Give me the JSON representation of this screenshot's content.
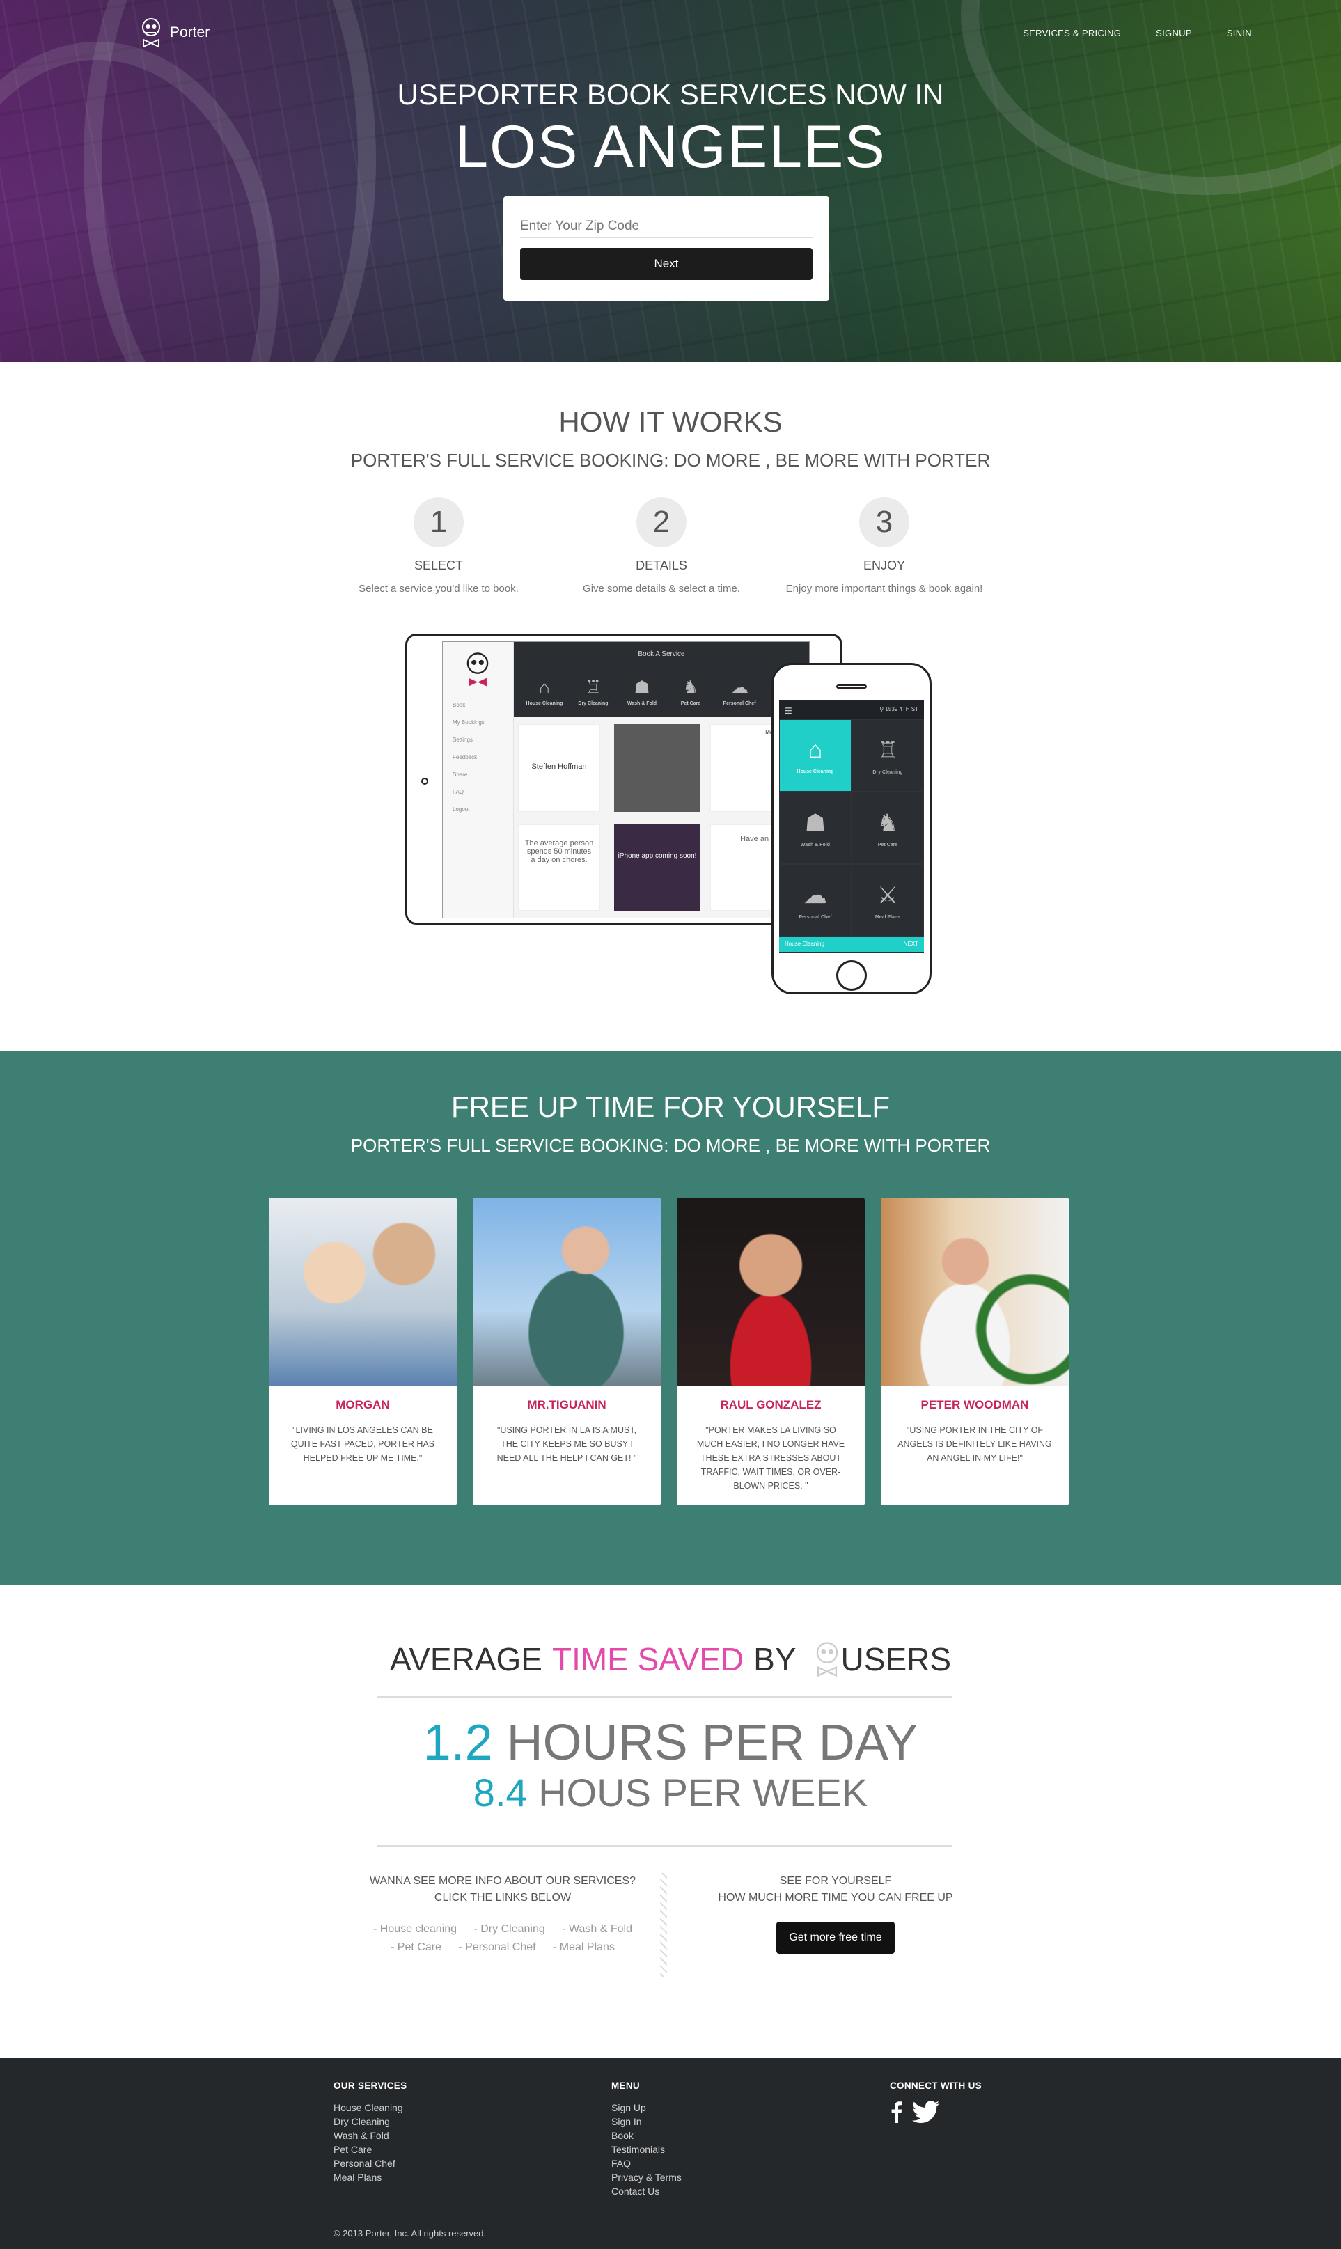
{
  "header": {
    "brand": "Porter",
    "nav": [
      "SERVICES & PRICING",
      "SIGNUP",
      "SININ"
    ]
  },
  "hero": {
    "title": "USEPORTER BOOK SERVICES NOW IN",
    "city": "LOS ANGELES",
    "zip_placeholder": "Enter Your Zip Code",
    "next_label": "Next"
  },
  "how": {
    "title": "HOW IT WORKS",
    "subtitle": "PORTER'S FULL SERVICE BOOKING: DO MORE , BE MORE WITH PORTER",
    "steps": [
      {
        "num": "1",
        "label": "SELECT",
        "desc": "Select a service you'd like to book."
      },
      {
        "num": "2",
        "label": "DETAILS",
        "desc": "Give some details & select a time."
      },
      {
        "num": "3",
        "label": "ENJOY",
        "desc": "Enjoy more important things & book again!"
      }
    ],
    "tablet": {
      "header": "Book A Service",
      "sidebar": [
        "Book",
        "My Bookings",
        "Settings",
        "Feedback",
        "Share",
        "FAQ",
        "Logout"
      ],
      "services": [
        "House Cleaning",
        "Dry Cleaning",
        "Wash & Fold",
        "Pet Care",
        "Personal Chef"
      ],
      "card_name": "Steffen Hoffman",
      "card_fact": "The average person spends 50 minutes a day on chores.",
      "card_app": "iPhone app coming soon!",
      "card_idea": "Have an idea for a service?",
      "card_chef": "Matt Jennings"
    },
    "phone": {
      "location": "1539 4TH ST",
      "services": [
        "House Cleaning",
        "Dry Cleaning",
        "Wash & Fold",
        "Pet Care",
        "Personal Chef",
        "Meal Plans"
      ],
      "bottom": "House Cleaning",
      "bottom_action": "NEXT"
    }
  },
  "free": {
    "title": "FREE UP TIME FOR YOURSELF",
    "subtitle": "PORTER'S FULL SERVICE BOOKING: DO MORE , BE MORE WITH PORTER",
    "testimonials": [
      {
        "name": "MORGAN",
        "quote": "\"LIVING IN LOS ANGELES CAN BE QUITE FAST PACED, PORTER HAS HELPED FREE UP ME TIME.\""
      },
      {
        "name": "MR.TIGUANIN",
        "quote": "\"USING PORTER IN LA IS A MUST, THE CITY KEEPS ME SO BUSY I NEED ALL THE HELP I CAN GET! \""
      },
      {
        "name": "RAUL GONZALEZ",
        "quote": "\"PORTER MAKES LA LIVING SO MUCH EASIER, I NO LONGER HAVE THESE EXTRA STRESSES ABOUT TRAFFIC, WAIT TIMES, OR OVER-BLOWN PRICES. \""
      },
      {
        "name": "PETER WOODMAN",
        "quote": "\"USING PORTER IN THE CITY OF ANGELS IS DEFINITELY LIKE HAVING AN ANGEL IN MY LIFE!\""
      }
    ]
  },
  "stats": {
    "avg_pre": "AVERAGE",
    "avg_highlight": "TIME SAVED",
    "avg_by": "BY",
    "avg_post": "USERS",
    "day_value": "1.2",
    "day_label": "HOURS PER DAY",
    "week_value": "8.4",
    "week_label": "HOUS PER WEEK",
    "info_line1": "WANNA SEE MORE INFO ABOUT OUR SERVICES?",
    "info_line2": "CLICK THE LINKS BELOW",
    "links_row1": [
      "- House cleaning",
      "- Dry Cleaning",
      "- Wash & Fold"
    ],
    "links_row2": [
      "- Pet Care",
      "- Personal Chef",
      "- Meal Plans"
    ],
    "see_line1": "SEE FOR YOURSELF",
    "see_line2": "HOW MUCH MORE TIME YOU CAN FREE UP",
    "cta": "Get more free time"
  },
  "footer": {
    "services_title": "OUR SERVICES",
    "services": [
      "House Cleaning",
      "Dry Cleaning",
      "Wash & Fold",
      "Pet Care",
      "Personal Chef",
      "Meal Plans"
    ],
    "menu_title": "MENU",
    "menu": [
      "Sign Up",
      "Sign In",
      "Book",
      "Testimonials",
      "FAQ",
      "Privacy & Terms",
      "Contact Us"
    ],
    "connect_title": "CONNECT WITH US",
    "copyright": "© 2013 Porter, Inc. All rights reserved."
  },
  "colors": {
    "teal_section": "#3e7f73",
    "accent_pink": "#e24ba9",
    "name_red": "#c8245a",
    "accent_teal": "#1fa7c0",
    "phone_active": "#1fcfc8",
    "footer_bg": "#25282b"
  },
  "icons": [
    "skull-bowtie-logo-icon",
    "facebook-icon",
    "twitter-icon",
    "hanger-icon",
    "shirt-icon",
    "basket-icon",
    "cat-icon",
    "chef-hat-icon",
    "fork-knife-icon",
    "hamburger-menu-icon",
    "location-pin-icon"
  ]
}
